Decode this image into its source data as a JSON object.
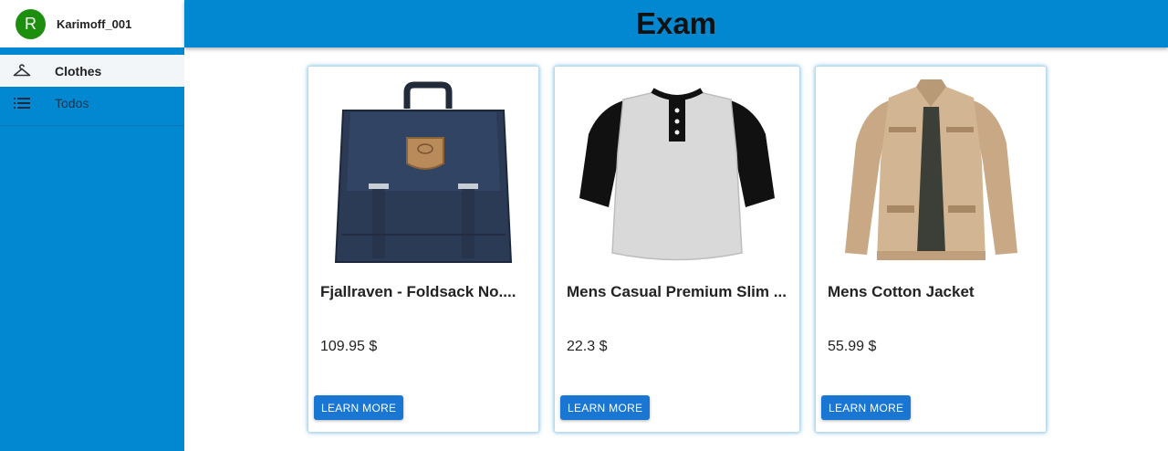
{
  "sidebar": {
    "user": {
      "initial": "R",
      "name": "Karimoff_001"
    },
    "items": [
      {
        "label": "Clothes",
        "icon": "hanger-icon",
        "active": true
      },
      {
        "label": "Todos",
        "icon": "list-icon",
        "active": false
      }
    ]
  },
  "header": {
    "title": "Exam"
  },
  "products": [
    {
      "title": "Fjallraven - Foldsack No....",
      "price": "109.95 $",
      "button": "LEARN MORE",
      "image": "backpack"
    },
    {
      "title": "Mens Casual Premium Slim ...",
      "price": "22.3 $",
      "button": "LEARN MORE",
      "image": "raglan-shirt"
    },
    {
      "title": "Mens Cotton Jacket",
      "price": "55.99 $",
      "button": "LEARN MORE",
      "image": "cotton-jacket"
    }
  ],
  "colors": {
    "primary": "#0288d1",
    "button": "#1976d2",
    "avatar": "#1e8e0f"
  }
}
